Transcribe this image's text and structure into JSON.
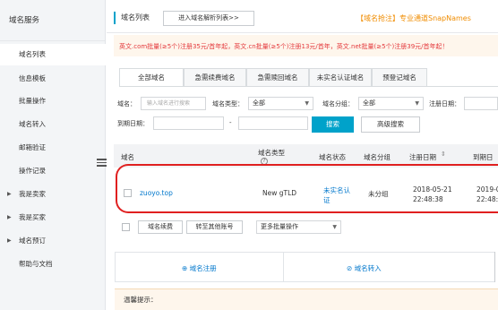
{
  "sidebar": {
    "header": "域名服务",
    "items": [
      {
        "label": "域名列表",
        "active": true,
        "arrow": false
      },
      {
        "label": "信息模板",
        "active": false,
        "arrow": false
      },
      {
        "label": "批量操作",
        "active": false,
        "arrow": false
      },
      {
        "label": "域名转入",
        "active": false,
        "arrow": false
      },
      {
        "label": "邮箱验证",
        "active": false,
        "arrow": false
      },
      {
        "label": "操作记录",
        "active": false,
        "arrow": false
      },
      {
        "label": "我是卖家",
        "active": false,
        "arrow": true
      },
      {
        "label": "我是买家",
        "active": false,
        "arrow": true
      },
      {
        "label": "域名预订",
        "active": false,
        "arrow": true
      },
      {
        "label": "帮助与文档",
        "active": false,
        "arrow": false
      }
    ]
  },
  "header": {
    "title": "域名列表",
    "parse_button": "进入域名解析列表>>",
    "promo": "【域名抢注】专业通道SnapNames",
    "notice": "英文.com批量(≥5个)注册35元/首年起，英文.cn批量(≥5个)注册13元/首年，英文.net批量(≥5个)注册39元/首年起！"
  },
  "tabs": [
    "全部域名",
    "急需续费域名",
    "急需赎回域名",
    "未实名认证域名",
    "预登记域名"
  ],
  "filters": {
    "domain_label": "域名：",
    "domain_placeholder": "输入域名进行搜索",
    "type_label": "域名类型：",
    "type_value": "全部",
    "group_label": "域名分组：",
    "group_value": "全部",
    "reg_date_label": "注册日期：",
    "expire_label": "到期日期：",
    "dash": "-",
    "search_button": "搜索",
    "advanced_button": "高级搜索"
  },
  "table": {
    "headers": {
      "domain": "域名",
      "type": "域名类型",
      "type_help": "?",
      "status": "域名状态",
      "group": "域名分组",
      "reg_date": "注册日期",
      "expire_date": "到期日"
    },
    "rows": [
      {
        "domain": "zuoyo.top",
        "type": "New gTLD",
        "status_line1": "未实名认",
        "status_line2": "证",
        "group": "未分组",
        "reg_date": "2018-05-21",
        "reg_time": "22:48:38",
        "expire_date": "2019-0",
        "expire_time": "22:48:3"
      }
    ]
  },
  "bulk": {
    "renew": "域名续费",
    "transfer": "转至其他账号",
    "more": "更多批量操作"
  },
  "actions": {
    "register": "域名注册",
    "transfer_in": "域名转入"
  },
  "tip": "温馨提示："
}
